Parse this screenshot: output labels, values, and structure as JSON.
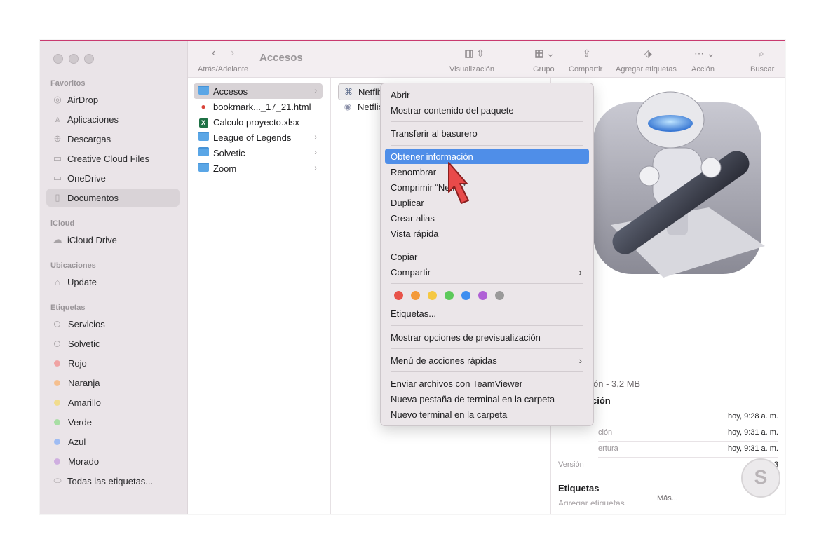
{
  "toolbar": {
    "title": "Accesos",
    "back_label": "Atrás/Adelante",
    "view_label": "Visualización",
    "group_label": "Grupo",
    "share_label": "Compartir",
    "tags_label": "Agregar etiquetas",
    "action_label": "Acción",
    "search_label": "Buscar"
  },
  "sidebar": {
    "favorites_title": "Favoritos",
    "favorites": [
      {
        "label": "AirDrop",
        "icon": "airdrop-icon"
      },
      {
        "label": "Aplicaciones",
        "icon": "applications-icon"
      },
      {
        "label": "Descargas",
        "icon": "downloads-icon"
      },
      {
        "label": "Creative Cloud Files",
        "icon": "folder-icon"
      },
      {
        "label": "OneDrive",
        "icon": "folder-icon"
      },
      {
        "label": "Documentos",
        "icon": "document-icon"
      }
    ],
    "icloud_title": "iCloud",
    "icloud": [
      {
        "label": "iCloud Drive",
        "icon": "cloud-icon"
      }
    ],
    "locations_title": "Ubicaciones",
    "locations": [
      {
        "label": "Update",
        "icon": "disk-icon"
      }
    ],
    "tags_title": "Etiquetas",
    "tags": [
      {
        "label": "Servicios",
        "color": "hollow"
      },
      {
        "label": "Solvetic",
        "color": "hollow"
      },
      {
        "label": "Rojo",
        "color": "#f0a3a3"
      },
      {
        "label": "Naranja",
        "color": "#f5bf8f"
      },
      {
        "label": "Amarillo",
        "color": "#f1dc8e"
      },
      {
        "label": "Verde",
        "color": "#a8dea4"
      },
      {
        "label": "Azul",
        "color": "#9fbcf3"
      },
      {
        "label": "Morado",
        "color": "#cfaee0"
      },
      {
        "label": "Todas las etiquetas...",
        "color": "all"
      }
    ]
  },
  "column1": [
    {
      "label": "Accesos",
      "type": "folder"
    },
    {
      "label": "bookmark..._17_21.html",
      "type": "chrome"
    },
    {
      "label": "Calculo proyecto.xlsx",
      "type": "xlsx"
    },
    {
      "label": "League of Legends",
      "type": "folder"
    },
    {
      "label": "Solvetic",
      "type": "folder"
    },
    {
      "label": "Zoom",
      "type": "folder"
    }
  ],
  "column2": [
    {
      "label": "Netflix",
      "type": "app"
    },
    {
      "label": "Netflix",
      "type": "file"
    }
  ],
  "context_menu": {
    "open": "Abrir",
    "show_package": "Mostrar contenido del paquete",
    "trash": "Transferir al basurero",
    "get_info": "Obtener información",
    "rename": "Renombrar",
    "compress": "Comprimir “Netflix”",
    "duplicate": "Duplicar",
    "alias": "Crear alias",
    "quick_look": "Vista rápida",
    "copy": "Copiar",
    "share": "Compartir",
    "tag_colors": [
      "#e8534a",
      "#f39a3a",
      "#f5c842",
      "#5cc95a",
      "#3e8ef0",
      "#b061d6",
      "#9a9a9a"
    ],
    "tags": "Etiquetas...",
    "preview_options": "Mostrar opciones de previsualización",
    "quick_actions": "Menú de acciones rápidas",
    "teamviewer": "Enviar archivos con TeamViewer",
    "new_terminal_tab": "Nueva pestaña de terminal en la carpeta",
    "new_terminal": "Nuevo terminal en la carpeta"
  },
  "preview": {
    "kind_size": "ón - 3,2 MB",
    "info_title": "ción",
    "rows": [
      {
        "key": "",
        "value": "hoy, 9:28 a. m."
      },
      {
        "key": "ción",
        "value": "hoy, 9:31 a. m."
      },
      {
        "key": "ertura",
        "value": "hoy, 9:31 a. m."
      },
      {
        "key": "Versión",
        "value": "1.3"
      }
    ],
    "tags_title": "Etiquetas",
    "tags_placeholder": "Agregar etiquetas",
    "more_label": "Más..."
  }
}
